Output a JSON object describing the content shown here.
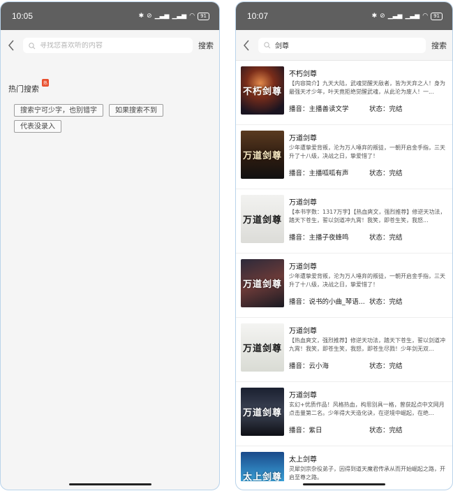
{
  "left": {
    "status_time": "10:05",
    "battery": "91",
    "search_placeholder": "寻找您喜欢听的内容",
    "search_button": "搜索",
    "hot_title": "热门搜索",
    "hot_badge": "热",
    "tags": [
      "搜索宁可少字，也别错字",
      "如果搜索不到",
      "代表没录入"
    ]
  },
  "right": {
    "status_time": "10:07",
    "battery": "91",
    "search_value": "剑尊",
    "search_button": "搜索",
    "results": [
      {
        "title": "不朽剑尊",
        "desc": "【内容简介】九天大陆，武魂觉醒天敌者，皆为天弃之人！身为最强天才少年，叶天竟拒绝觉醒武魂，从此沦为废人！一...",
        "narrator": "播音：主播善读文学",
        "status": "状态：完结",
        "cover_text": "不朽剑尊"
      },
      {
        "title": "万道剑尊",
        "desc": "少年遭挚爱背叛，沦为万人唾弃的叛徒，一朝开启金手指，三天升了十八级，决战之日，挚爱惜了！",
        "narrator": "播音：主播呱呱有声",
        "status": "状态：完结",
        "cover_text": "万道剑尊"
      },
      {
        "title": "万道剑尊",
        "desc": "【本书字数：1317万字】【热血爽文，强烈推荐】修逆天功法，踏天下苍生，誓以剑道冲九霄！我笑，即苍生笑，我怒...",
        "narrator": "播音：主播子夜蜂鸣",
        "status": "状态：完结",
        "cover_text": "万道剑尊"
      },
      {
        "title": "万道剑尊",
        "desc": "少年遭挚爱背叛，沦为万人唾弃的叛徒，一朝开启金手指，三天升了十八级，决战之日，挚爱惜了！",
        "narrator": "播音：说书的小曲_琴语...",
        "status": "状态：完结",
        "cover_text": "万道剑尊"
      },
      {
        "title": "万道剑尊",
        "desc": "【热血爽文，强烈推荐】修逆天功法，踏天下苍生，誓以剑道冲九霄！我笑，即苍生笑，我怒，即苍生尽戮！少年剑无双...",
        "narrator": "播音：云小海",
        "status": "状态：完结",
        "cover_text": "万道剑尊"
      },
      {
        "title": "万道剑尊",
        "desc": "玄幻+优质作品！风格热血，构思别具一格，曾获起点中文网月点击量第二名。少年得大天造化诀，在逆境中崛起，在绝...",
        "narrator": "播音：紫日",
        "status": "状态：完结",
        "cover_text": "万道剑尊"
      },
      {
        "title": "太上剑尊",
        "desc": "灵犀剑宗杂役弟子，因得到道天魔君传承从而开始崛起之路，开启至尊之路。",
        "narrator": "",
        "status": "",
        "cover_text": "太上剑尊"
      }
    ]
  }
}
